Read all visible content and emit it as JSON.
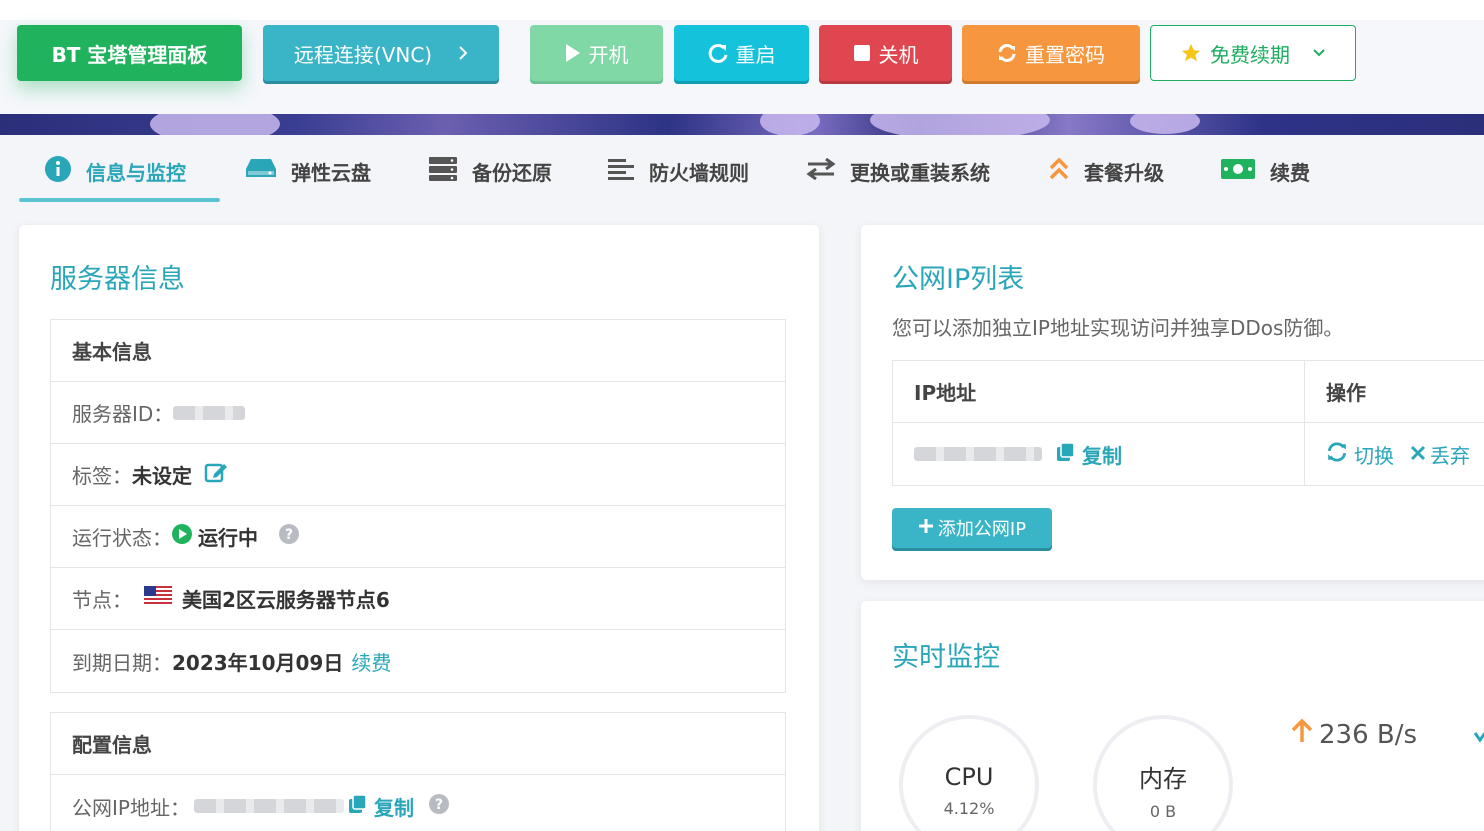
{
  "toolbar": {
    "bt_label": "BT 宝塔管理面板",
    "vnc_label": "远程连接(VNC)",
    "start_label": "开机",
    "restart_label": "重启",
    "shutdown_label": "关机",
    "reset_pwd_label": "重置密码",
    "renew_label": "免费续期"
  },
  "tabs": [
    {
      "label": "信息与监控",
      "icon": "info-circle-icon",
      "active": true
    },
    {
      "label": "弹性云盘",
      "icon": "disk-icon"
    },
    {
      "label": "备份还原",
      "icon": "server-stack-icon"
    },
    {
      "label": "防火墙规则",
      "icon": "align-left-icon"
    },
    {
      "label": "更换或重装系统",
      "icon": "swap-arrows-icon"
    },
    {
      "label": "套餐升级",
      "icon": "double-chevron-up-icon"
    },
    {
      "label": "续费",
      "icon": "money-icon"
    }
  ],
  "server_info": {
    "title": "服务器信息",
    "basic_section": "基本信息",
    "id_label": "服务器ID：",
    "tag_label": "标签：",
    "tag_value": "未设定",
    "status_label": "运行状态：",
    "status_value": "运行中",
    "node_label": "节点：",
    "node_value": "美国2区云服务器节点6",
    "expire_label": "到期日期：",
    "expire_value": "2023年10月09日",
    "expire_renew": "续费",
    "config_section": "配置信息",
    "public_ip_label": "公网IP地址：",
    "copy_label": "复制"
  },
  "public_ip": {
    "title": "公网IP列表",
    "description": "您可以添加独立IP地址实现访问并独享DDos防御。",
    "col_ip": "IP地址",
    "col_action": "操作",
    "copy_label": "复制",
    "switch_label": "切换",
    "discard_label": "丢弃",
    "add_label": "添加公网IP"
  },
  "monitor": {
    "title": "实时监控",
    "cpu_label": "CPU",
    "cpu_value": "4.12%",
    "mem_label": "内存",
    "mem_value": "0 B",
    "net_up": "236 B/s"
  },
  "colors": {
    "accent": "#2aa6b9",
    "green": "#20b25d",
    "red": "#e0464f",
    "orange": "#f6963e"
  }
}
